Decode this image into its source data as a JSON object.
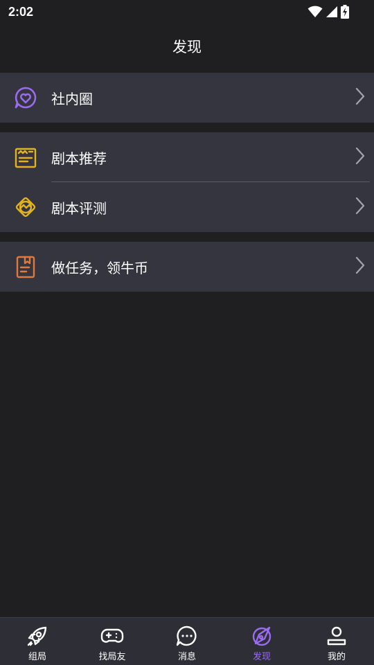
{
  "status_bar": {
    "time": "2:02"
  },
  "header": {
    "title": "发现"
  },
  "groups": [
    {
      "items": [
        {
          "label": "社内圈",
          "icon": "heart-bubble-icon",
          "color": "#9b6cf0"
        }
      ]
    },
    {
      "items": [
        {
          "label": "剧本推荐",
          "icon": "script-recommend-icon",
          "color": "#e3b31d"
        },
        {
          "label": "剧本评测",
          "icon": "script-review-icon",
          "color": "#e3b31d"
        }
      ]
    },
    {
      "items": [
        {
          "label": "做任务，领牛币",
          "icon": "task-bookmark-icon",
          "color": "#e07a3c"
        }
      ]
    }
  ],
  "bottom_nav": {
    "active": "发现",
    "active_color": "#9b6cf0",
    "items": [
      {
        "label": "组局",
        "icon": "rocket-icon"
      },
      {
        "label": "找局友",
        "icon": "gamepad-icon"
      },
      {
        "label": "消息",
        "icon": "chat-dots-icon"
      },
      {
        "label": "发现",
        "icon": "compass-icon"
      },
      {
        "label": "我的",
        "icon": "user-icon"
      }
    ]
  }
}
